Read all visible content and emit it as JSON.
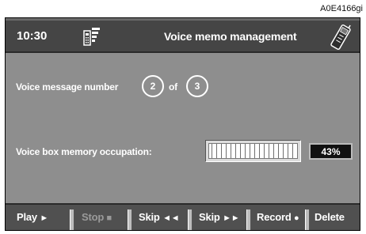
{
  "ref_code": "A0E4166gi",
  "header": {
    "time": "10:30",
    "title": "Voice memo management",
    "icons": [
      "phone-signal-icon",
      "mobile-phone-icon"
    ]
  },
  "voice_message": {
    "label": "Voice message number",
    "current": "2",
    "of": "of",
    "total": "3"
  },
  "memory": {
    "label": "Voice box memory occupation:",
    "percent_text": "43%",
    "occupation": 0.43
  },
  "footer": {
    "play": "Play",
    "stop": "Stop",
    "skip_back": "Skip",
    "skip_forward": "Skip",
    "record": "Record",
    "delete": "Delete",
    "glyphs": {
      "play": "►",
      "stop": "■",
      "skip_back": "◄◄",
      "skip_forward": "►►",
      "record": "●"
    }
  }
}
